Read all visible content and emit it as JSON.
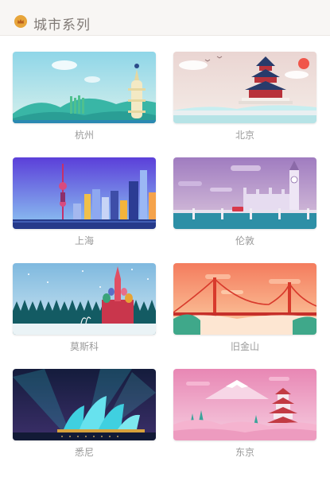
{
  "header": {
    "title": "城市系列",
    "icon": "crown-badge-icon"
  },
  "cities": [
    {
      "name": "杭州"
    },
    {
      "name": "北京"
    },
    {
      "name": "上海"
    },
    {
      "name": "伦敦"
    },
    {
      "name": "莫斯科"
    },
    {
      "name": "旧金山"
    },
    {
      "name": "悉尼"
    },
    {
      "name": "东京"
    }
  ],
  "colors": {
    "header_bg": "#f8f6f4",
    "title_text": "#807a76",
    "label_text": "#9a9a9a",
    "badge": "#e7a53a"
  }
}
